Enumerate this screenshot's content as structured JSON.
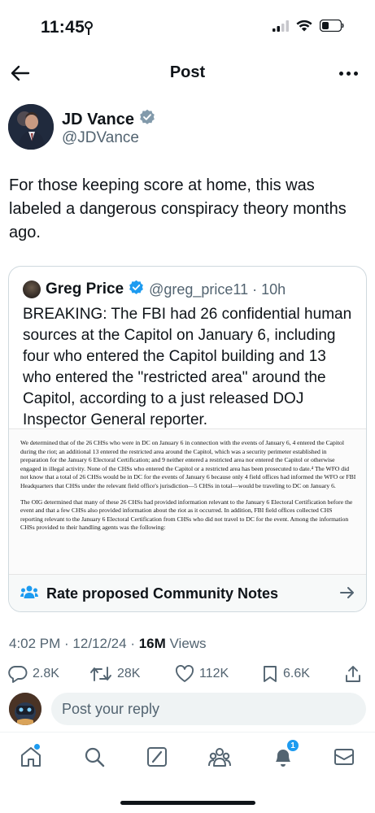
{
  "status_bar": {
    "time": "11:45"
  },
  "header": {
    "title": "Post"
  },
  "tweet": {
    "author_name": "JD Vance",
    "author_handle": "@JDVance",
    "text": "For those keeping score at home, this was labeled a dangerous conspiracy theory months ago.",
    "timestamp_prefix": "4:02 PM · 12/12/24 · ",
    "views_count": "16M",
    "views_label": " Views"
  },
  "quote": {
    "author_name": "Greg Price",
    "meta": "@greg_price11 · 10h",
    "text": "BREAKING: The FBI had 26 confidential human sources at the Capitol on January 6, including four who entered the Capitol building and 13 who entered the \"restricted area\" around the Capitol, according to a just released DOJ Inspector General reporter.",
    "doc_paragraph_1": "We determined that of the 26 CHSs who were in DC on January 6 in connection with the events of January 6, 4 entered the Capitol during the riot; an additional 13 entered the restricted area around the Capitol, which was a security perimeter established in preparation for the January 6 Electoral Certification; and 9 neither entered a restricted area nor entered the Capitol or otherwise engaged in illegal activity.  None of the CHSs who entered the Capitol or a restricted area has been prosecuted to date.⁴  The WFO did not know that a total of 26 CHSs would be in DC for the events of January 6 because only 4 field offices had informed the WFO or FBI Headquarters that CHSs under the relevant field office's jurisdiction—5 CHSs in total—would be traveling to DC on January 6.",
    "doc_paragraph_2": "The OIG determined that many of these 26 CHSs had provided information relevant to the January 6 Electoral Certification before the event and that a few CHSs also provided information about the riot as it occurred.  In addition, FBI field offices collected CHS reporting relevant to the January 6 Electoral Certification from CHSs who did not travel to DC for the event.  Among the information CHSs provided to their handling agents was the following:",
    "community_notes_label": "Rate proposed Community Notes"
  },
  "actions": {
    "replies": "2.8K",
    "reposts": "28K",
    "likes": "112K",
    "bookmarks": "6.6K"
  },
  "reply": {
    "placeholder": "Post your reply"
  },
  "tabbar": {
    "notifications_badge": "1"
  },
  "colors": {
    "accent": "#1d9bf0",
    "secondary_text": "#536471",
    "primary_text": "#0f1419"
  }
}
